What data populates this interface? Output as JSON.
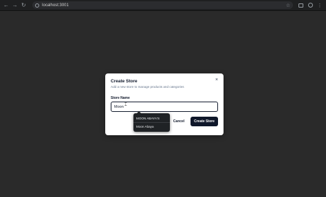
{
  "browser": {
    "back_icon": "arrow-left-icon",
    "forward_icon": "arrow-right-icon",
    "reload_icon": "reload-icon",
    "url": "localhost:3001",
    "bookmark_icon": "star-icon"
  },
  "dialog": {
    "title": "Create Store",
    "description": "Add a new store to manage products and categories",
    "field_label": "Store Name",
    "input_value": "Moon",
    "cancel_label": "Cancel",
    "submit_label": "Create Store",
    "close_glyph": "×"
  },
  "autocomplete": {
    "items": [
      {
        "label": "MOON ABAYA'S"
      },
      {
        "label": "Moon Abaya"
      }
    ]
  },
  "colors": {
    "backdrop": "#2a2a2a",
    "primary": "#0f172a",
    "dialog_bg": "#ffffff",
    "autocomplete_bg": "#1f2225"
  }
}
